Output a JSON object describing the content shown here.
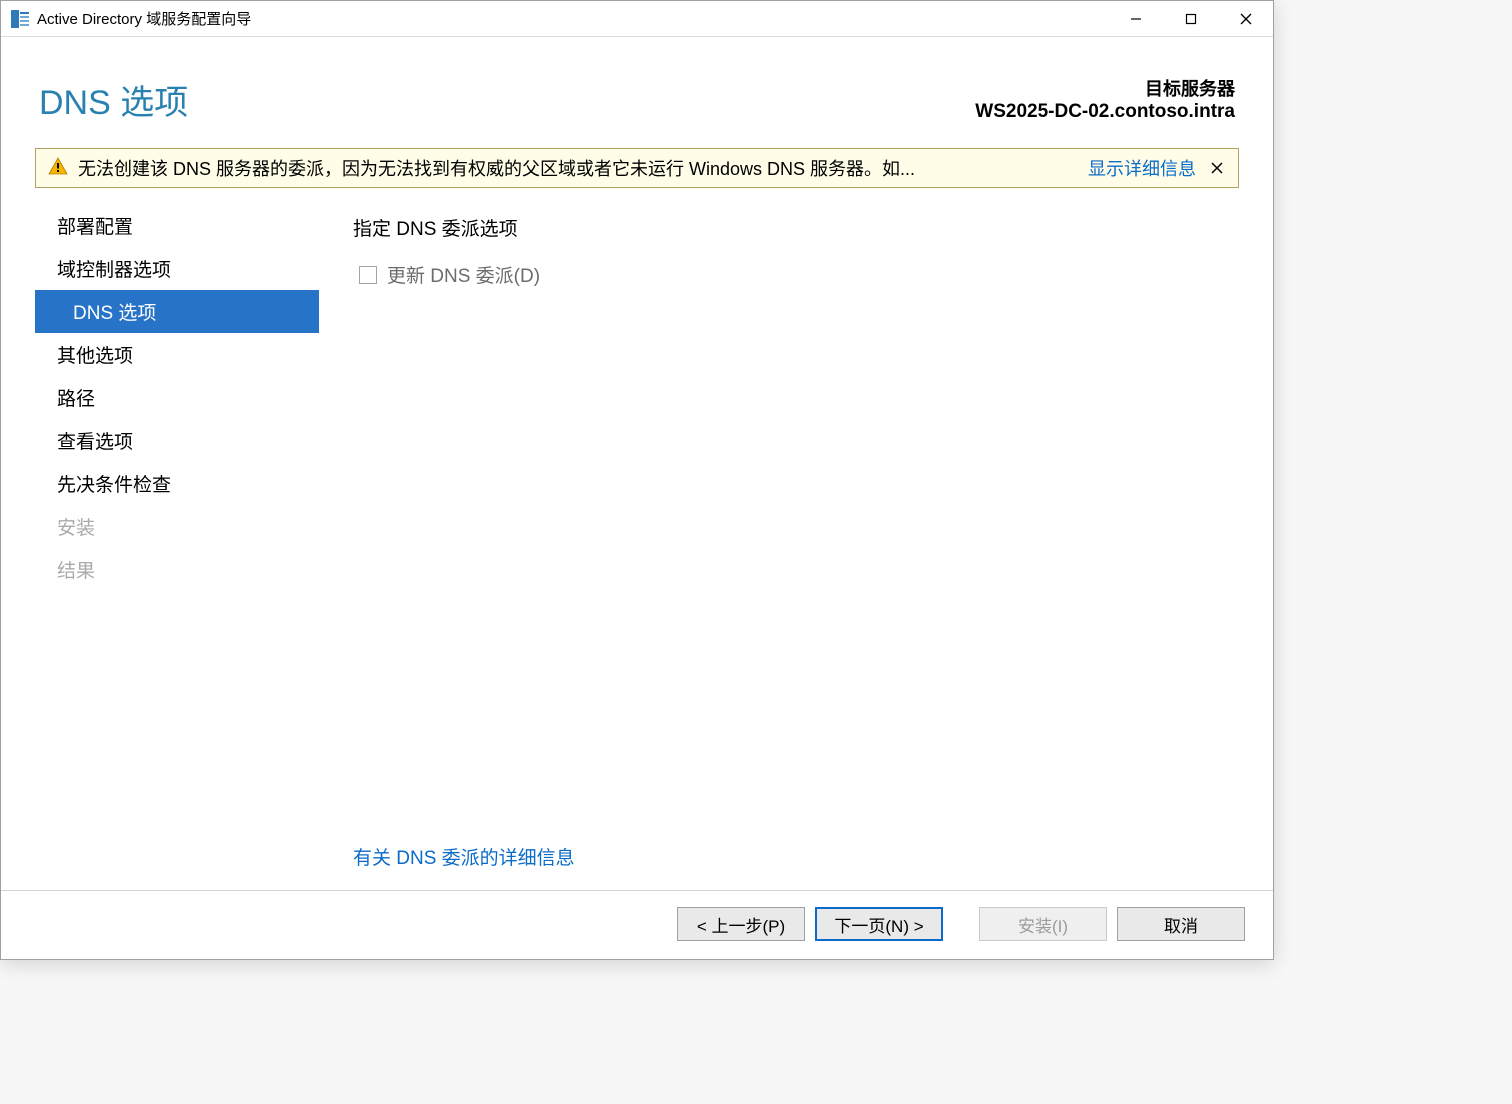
{
  "window": {
    "title": "Active Directory 域服务配置向导"
  },
  "header": {
    "page_title": "DNS 选项",
    "target_label": "目标服务器",
    "target_value": "WS2025-DC-02.contoso.intra"
  },
  "warning": {
    "text": "无法创建该 DNS 服务器的委派，因为无法找到有权威的父区域或者它未运行 Windows DNS 服务器。如...",
    "link": "显示详细信息"
  },
  "nav": {
    "items": [
      {
        "label": "部署配置",
        "state": "normal"
      },
      {
        "label": "域控制器选项",
        "state": "normal"
      },
      {
        "label": "DNS 选项",
        "state": "selected"
      },
      {
        "label": "其他选项",
        "state": "normal"
      },
      {
        "label": "路径",
        "state": "normal"
      },
      {
        "label": "查看选项",
        "state": "normal"
      },
      {
        "label": "先决条件检查",
        "state": "normal"
      },
      {
        "label": "安装",
        "state": "disabled"
      },
      {
        "label": "结果",
        "state": "disabled"
      }
    ]
  },
  "content": {
    "section_label": "指定 DNS 委派选项",
    "checkbox_label": "更新 DNS 委派(D)",
    "checkbox_checked": false,
    "more_link": "有关 DNS 委派的详细信息"
  },
  "footer": {
    "previous": "< 上一步(P)",
    "next": "下一页(N) >",
    "install": "安装(I)",
    "cancel": "取消"
  }
}
